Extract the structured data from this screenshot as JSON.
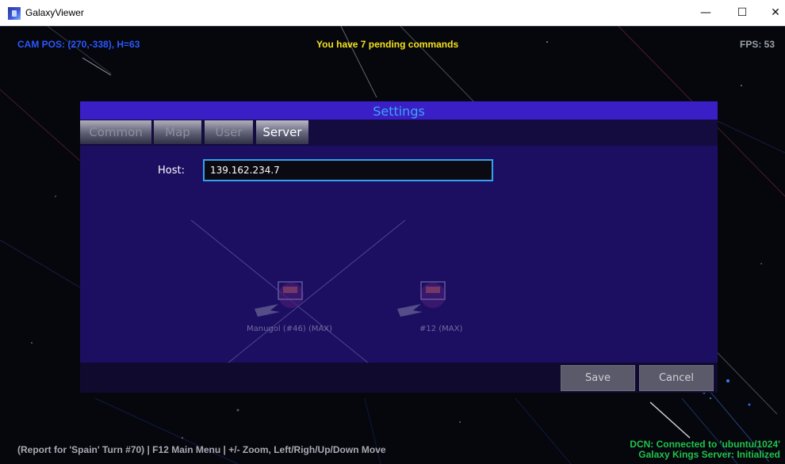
{
  "window": {
    "title": "GalaxyViewer",
    "minimize_glyph": "—",
    "maximize_glyph": "☐",
    "close_glyph": "✕"
  },
  "hud": {
    "cam_pos": "CAM POS: (270,-338), H=63",
    "pending": "You have 7 pending commands",
    "fps": "FPS: 53",
    "report": "(Report for 'Spain' Turn #70) | F12 Main Menu | +/- Zoom, Left/Righ/Up/Down Move",
    "dcn_line1": "DCN: Connected to 'ubuntu/1024'",
    "dcn_line2": "Galaxy Kings Server: Initialized"
  },
  "settings": {
    "title": "Settings",
    "tabs": [
      {
        "label": "Common",
        "active": false
      },
      {
        "label": "Map",
        "active": false
      },
      {
        "label": "User",
        "active": false
      },
      {
        "label": "Server",
        "active": true
      }
    ],
    "host_label": "Host:",
    "host_value": "139.162.234.7",
    "save_label": "Save",
    "cancel_label": "Cancel"
  },
  "map": {
    "ship_labels": [
      "Manugol (#46) (MAX)",
      "#12 (MAX)"
    ]
  },
  "colors": {
    "cam_pos": "#2b57ff",
    "pending": "#f5e11c",
    "dcn": "#21c24a",
    "dialog_header": "#3a1ec6",
    "dialog_body": "#1c0f62",
    "input_border": "#34a3ec"
  }
}
